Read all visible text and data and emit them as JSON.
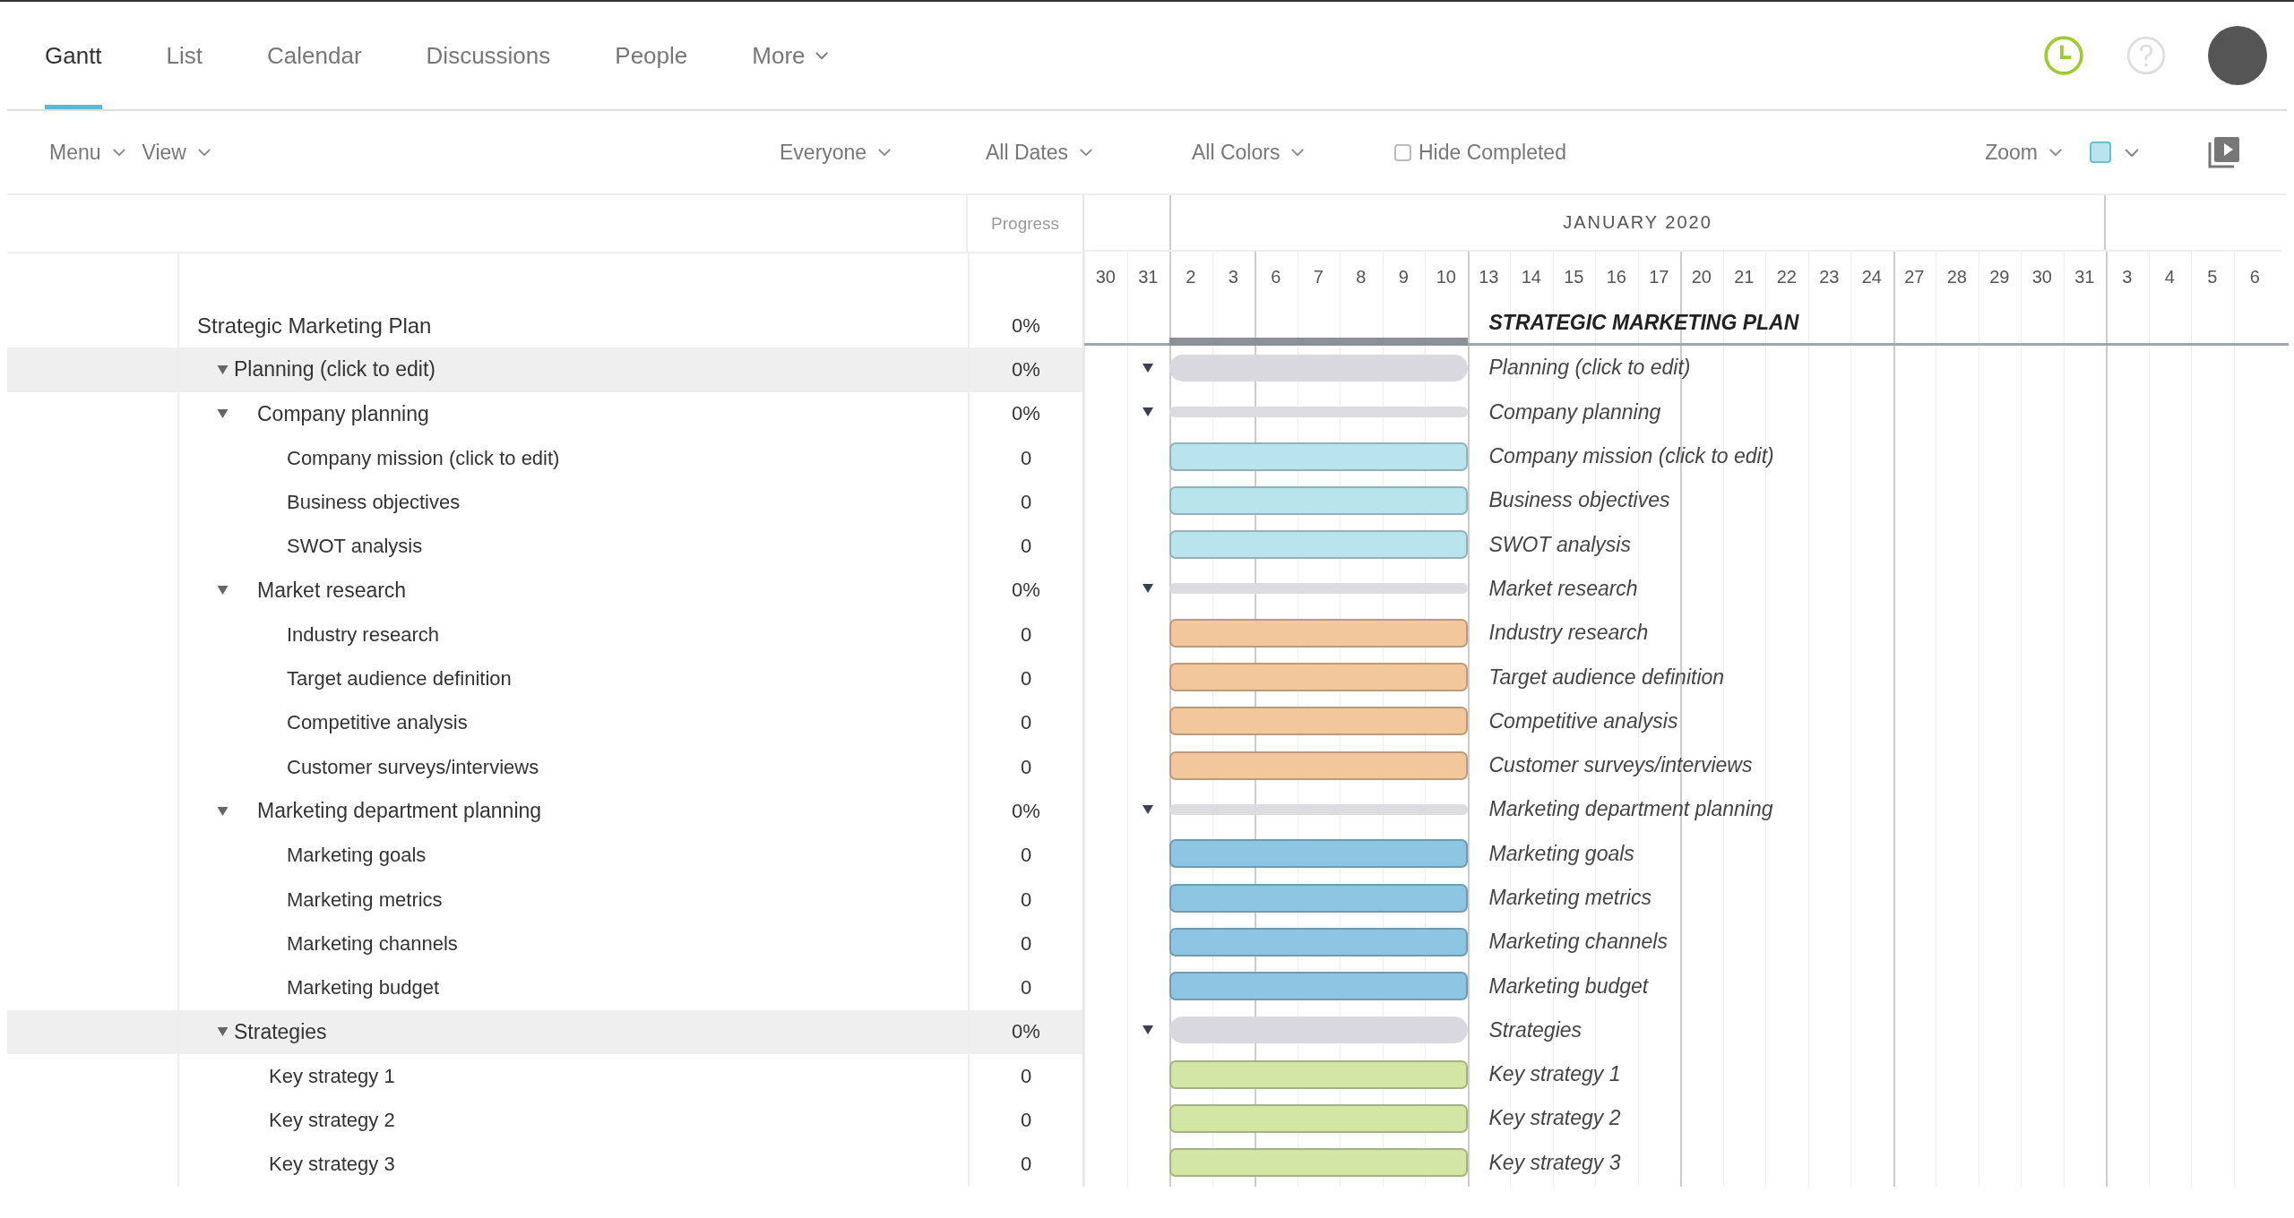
{
  "tabs": [
    {
      "label": "Gantt",
      "selected": true,
      "dropdown": false
    },
    {
      "label": "List",
      "selected": false,
      "dropdown": false
    },
    {
      "label": "Calendar",
      "selected": false,
      "dropdown": false
    },
    {
      "label": "Discussions",
      "selected": false,
      "dropdown": false
    },
    {
      "label": "People",
      "selected": false,
      "dropdown": false
    },
    {
      "label": "More",
      "selected": false,
      "dropdown": true
    }
  ],
  "toolbar": {
    "menus": [
      "Menu",
      "View"
    ],
    "filters": [
      "Everyone",
      "All Dates",
      "All Colors"
    ],
    "hide_completed": {
      "label": "Hide Completed",
      "checked": false
    },
    "zoom": "Zoom"
  },
  "table": {
    "progress_header": "Progress"
  },
  "timeline": {
    "month": "JANUARY 2020",
    "days": [
      "30",
      "31",
      "2",
      "3",
      "6",
      "7",
      "8",
      "9",
      "10",
      "13",
      "14",
      "15",
      "16",
      "17",
      "20",
      "21",
      "22",
      "23",
      "24",
      "27",
      "28",
      "29",
      "30",
      "31",
      "3",
      "4",
      "5",
      "6"
    ]
  },
  "project": {
    "name": "Strategic Marketing Plan",
    "progress": "0%",
    "bar_label": "STRATEGIC MARKETING PLAN",
    "children": [
      {
        "kind": "group",
        "name": "Planning (click to edit)",
        "progress": "0%",
        "bar_label": "Planning (click to edit)",
        "expanded": true,
        "children": [
          {
            "kind": "group",
            "name": "Company planning",
            "progress": "0%",
            "bar_label": "Company planning",
            "expanded": true,
            "children": [
              {
                "kind": "task",
                "name": "Company mission (click to edit)",
                "progress": "0",
                "bar_label": "Company mission (click to edit)",
                "color": "#b9e4ee"
              },
              {
                "kind": "task",
                "name": "Business objectives",
                "progress": "0",
                "bar_label": "Business objectives",
                "color": "#b9e4ee"
              },
              {
                "kind": "task",
                "name": "SWOT analysis",
                "progress": "0",
                "bar_label": "SWOT analysis",
                "color": "#b9e4ee"
              }
            ]
          },
          {
            "kind": "group",
            "name": "Market research",
            "progress": "0%",
            "bar_label": "Market research",
            "expanded": true,
            "children": [
              {
                "kind": "task",
                "name": "Industry research",
                "progress": "0",
                "bar_label": "Industry research",
                "color": "#f2c79c"
              },
              {
                "kind": "task",
                "name": "Target audience definition",
                "progress": "0",
                "bar_label": "Target audience definition",
                "color": "#f2c79c"
              },
              {
                "kind": "task",
                "name": "Competitive analysis",
                "progress": "0",
                "bar_label": "Competitive analysis",
                "color": "#f2c79c"
              },
              {
                "kind": "task",
                "name": "Customer surveys/interviews",
                "progress": "0",
                "bar_label": "Customer surveys/interviews",
                "color": "#f2c79c"
              }
            ]
          },
          {
            "kind": "group",
            "name": "Marketing department planning",
            "progress": "0%",
            "bar_label": "Marketing department planning",
            "expanded": true,
            "children": [
              {
                "kind": "task",
                "name": "Marketing goals",
                "progress": "0",
                "bar_label": "Marketing goals",
                "color": "#8ec5e2"
              },
              {
                "kind": "task",
                "name": "Marketing metrics",
                "progress": "0",
                "bar_label": "Marketing metrics",
                "color": "#8ec5e2"
              },
              {
                "kind": "task",
                "name": "Marketing channels",
                "progress": "0",
                "bar_label": "Marketing channels",
                "color": "#8ec5e2"
              },
              {
                "kind": "task",
                "name": "Marketing budget",
                "progress": "0",
                "bar_label": "Marketing budget",
                "color": "#8ec5e2"
              }
            ]
          }
        ]
      },
      {
        "kind": "group",
        "name": "Strategies",
        "progress": "0%",
        "bar_label": "Strategies",
        "expanded": true,
        "children": [
          {
            "kind": "task",
            "name": "Key strategy 1",
            "progress": "0",
            "bar_label": "Key strategy 1",
            "color": "#d4e6a5"
          },
          {
            "kind": "task",
            "name": "Key strategy 2",
            "progress": "0",
            "bar_label": "Key strategy 2",
            "color": "#d4e6a5"
          },
          {
            "kind": "task",
            "name": "Key strategy 3",
            "progress": "0",
            "bar_label": "Key strategy 3",
            "color": "#d4e6a5"
          }
        ]
      }
    ]
  }
}
